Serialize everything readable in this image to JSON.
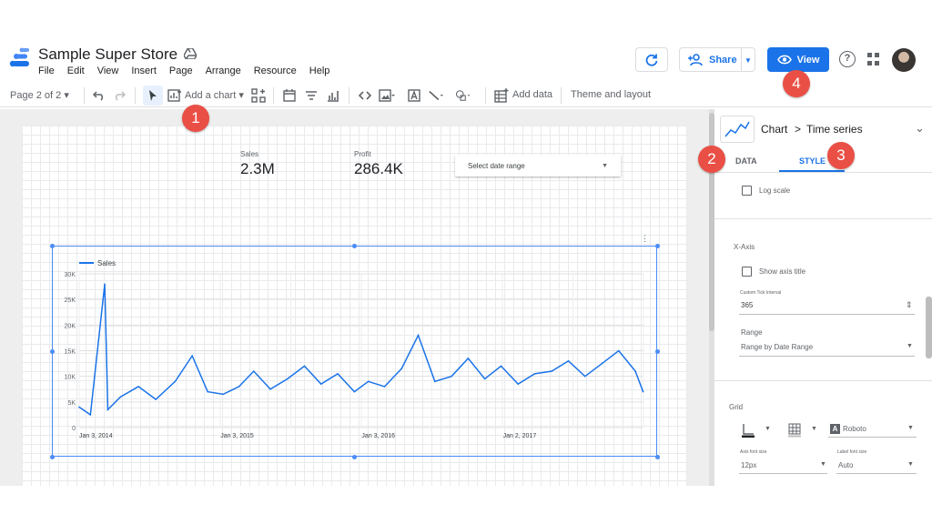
{
  "app": {
    "title": "Sample Super Store",
    "menu": [
      "File",
      "Edit",
      "View",
      "Insert",
      "Page",
      "Arrange",
      "Resource",
      "Help"
    ],
    "share_label": "Share",
    "view_label": "View",
    "help_symbol": "?"
  },
  "toolbar": {
    "page_indicator": "Page 2 of 2",
    "add_chart": "Add a chart",
    "add_data": "Add data",
    "theme_layout": "Theme and layout"
  },
  "scorecards": [
    {
      "label": "Sales",
      "value": "2.3M"
    },
    {
      "label": "Profit",
      "value": "286.4K"
    }
  ],
  "date_control": {
    "label": "Select date range"
  },
  "chart_data": {
    "type": "line",
    "legend": "Sales",
    "ylim": [
      0,
      30000
    ],
    "yticks": [
      "0",
      "5K",
      "10K",
      "15K",
      "20K",
      "25K",
      "30K"
    ],
    "xtick_labels": [
      "Jan 3, 2014",
      "Jan 3, 2015",
      "Jan 3, 2016",
      "Jan 2, 2017"
    ],
    "series": [
      {
        "name": "Sales",
        "color": "#1a73e8",
        "x": [
          "2014-01-03",
          "2014-02-01",
          "2014-03-10",
          "2014-03-18",
          "2014-04-20",
          "2014-06-05",
          "2014-07-20",
          "2014-09-08",
          "2014-10-22",
          "2014-12-01",
          "2015-01-10",
          "2015-02-20",
          "2015-03-30",
          "2015-05-12",
          "2015-06-25",
          "2015-08-08",
          "2015-09-20",
          "2015-11-02",
          "2015-12-15",
          "2016-01-20",
          "2016-03-02",
          "2016-04-15",
          "2016-05-28",
          "2016-07-10",
          "2016-08-22",
          "2016-10-04",
          "2016-11-16",
          "2016-12-28",
          "2017-02-10",
          "2017-03-25",
          "2017-05-08",
          "2017-06-20",
          "2017-08-02",
          "2017-09-15",
          "2017-10-28",
          "2017-12-10",
          "2017-12-30"
        ],
        "values": [
          4000,
          2500,
          28000,
          3500,
          6000,
          8000,
          5500,
          9000,
          14000,
          7000,
          6500,
          8000,
          11000,
          7500,
          9500,
          12000,
          8500,
          10500,
          7000,
          9000,
          8000,
          11500,
          18000,
          9000,
          10000,
          13500,
          9500,
          12000,
          8500,
          10500,
          11000,
          13000,
          10000,
          12500,
          15000,
          11000,
          7000
        ]
      }
    ]
  },
  "panel": {
    "breadcrumb_chart": "Chart",
    "breadcrumb_sep": ">",
    "breadcrumb_type": "Time series",
    "tab_data": "DATA",
    "tab_style": "STYLE",
    "log_scale": "Log scale",
    "xaxis_title": "X-Axis",
    "show_axis_title": "Show axis title",
    "tick_interval_label": "Custom Tick Interval",
    "tick_interval_value": "365",
    "range_label": "Range",
    "range_value": "Range by Date Range",
    "grid_title": "Grid",
    "font_value": "Roboto",
    "axis_font_size_label": "Axis font size",
    "axis_font_size_value": "12px",
    "label_font_size_label": "Label font size",
    "label_font_size_value": "Auto"
  },
  "annotations": [
    "1",
    "2",
    "3",
    "4"
  ],
  "colors": {
    "accent": "#1a73e8",
    "badge": "#ea4f45"
  }
}
